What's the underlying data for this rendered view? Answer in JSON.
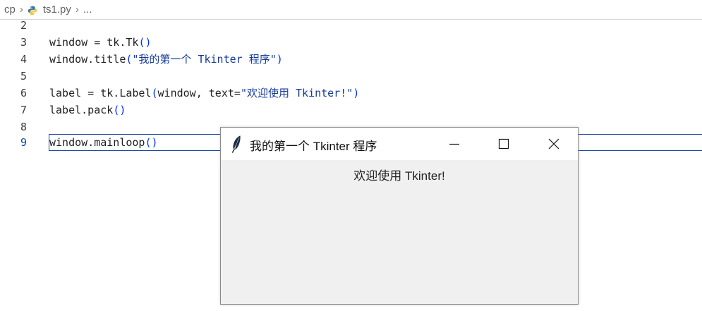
{
  "breadcrumb": {
    "folder": "cp",
    "file": "ts1.py",
    "more": "...",
    "python_icon": "python-icon",
    "chevron_icon": "chevron-right-icon"
  },
  "editor": {
    "lines": [
      {
        "number": "2",
        "code": ""
      },
      {
        "number": "3",
        "code": "window = tk.Tk()"
      },
      {
        "number": "4",
        "code": "window.title(\"我的第一个 Tkinter 程序\")"
      },
      {
        "number": "5",
        "code": ""
      },
      {
        "number": "6",
        "code": "label = tk.Label(window, text=\"欢迎使用 Tkinter!\")"
      },
      {
        "number": "7",
        "code": "label.pack()"
      },
      {
        "number": "8",
        "code": ""
      },
      {
        "number": "9",
        "code": "window.mainloop()"
      }
    ],
    "active_line": "9"
  },
  "tk_window": {
    "title": "我的第一个 Tkinter 程序",
    "label_text": "欢迎使用 Tkinter!",
    "icon": "tk-feather-icon",
    "buttons": {
      "minimize": "minimize-icon",
      "maximize": "maximize-icon",
      "close": "close-icon"
    }
  },
  "colors": {
    "line_number": "#3a3a3a",
    "active_line_number": "#0a4aa8",
    "paren": "#0431fa",
    "string": "#163a9a",
    "window_body": "#f0f0f0",
    "window_titlebar": "#ffffff"
  }
}
